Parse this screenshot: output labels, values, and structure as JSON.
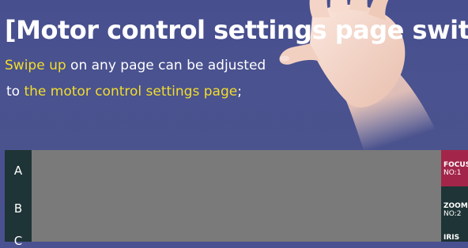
{
  "header": {
    "title": "[Motor control settings page switch]",
    "line1_highlight": "Swipe up",
    "line1_rest": " on any page can be adjusted",
    "line2_prefix": "to ",
    "line2_highlight": "the motor control settings page",
    "line2_suffix": ";"
  },
  "left_buttons": [
    "A",
    "B",
    "C"
  ],
  "right_buttons": [
    {
      "name": "FOCUS",
      "no": "NO:1"
    },
    {
      "name": "ZOOM",
      "no": "NO:2"
    },
    {
      "name": "IRIS",
      "no": ""
    }
  ],
  "colors": {
    "background": "#4a5190",
    "highlight": "#f2dd2c",
    "panel": "#7a7a7a",
    "sidebar": "#1f3436",
    "focus_active": "#a3264a"
  }
}
